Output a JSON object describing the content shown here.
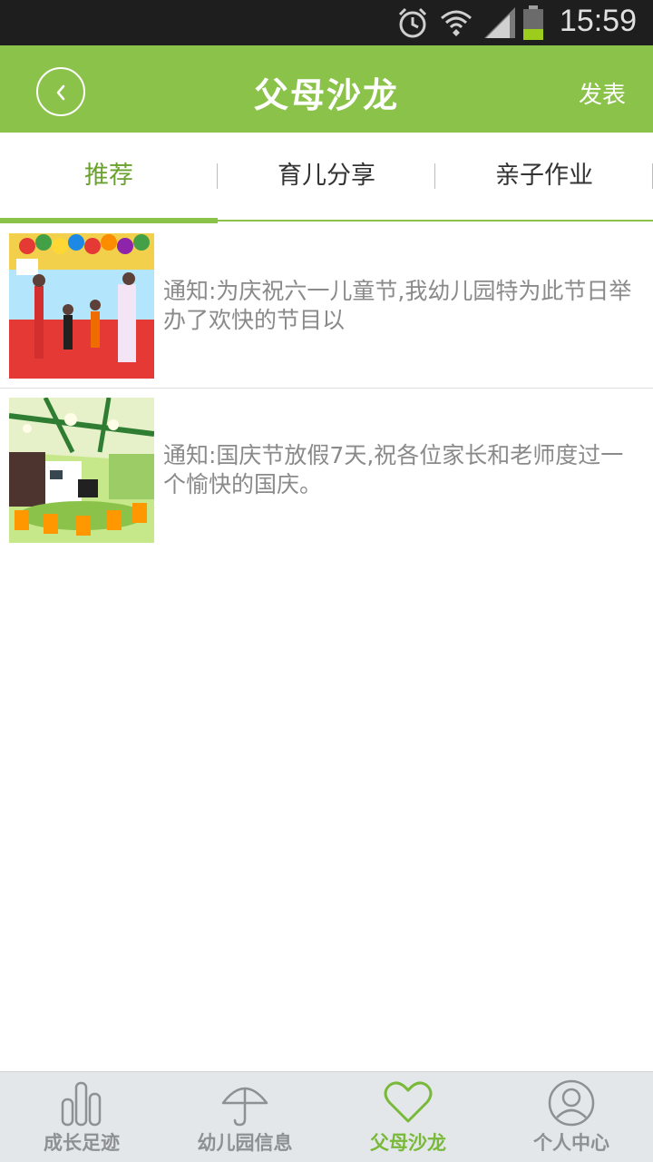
{
  "status_bar": {
    "time": "15:59",
    "icons": [
      "alarm-icon",
      "wifi-icon",
      "signal-icon",
      "battery-icon"
    ]
  },
  "header": {
    "title": "父母沙龙",
    "publish_label": "发表",
    "back_icon": "chevron-left-icon"
  },
  "tabs": [
    {
      "label": "推荐",
      "active": true
    },
    {
      "label": "育儿分享",
      "active": false
    },
    {
      "label": "亲子作业",
      "active": false
    }
  ],
  "posts": [
    {
      "text": "通知:为庆祝六一儿童节,我幼儿园特为此节日举办了欢快的节目以",
      "thumb": "performance-stage-photo"
    },
    {
      "text": "通知:国庆节放假7天,祝各位家长和老师度过一个愉快的国庆。",
      "thumb": "classroom-photo"
    }
  ],
  "bottom_nav": [
    {
      "label": "成长足迹",
      "icon": "bar-chart-icon",
      "active": false
    },
    {
      "label": "幼儿园信息",
      "icon": "umbrella-icon",
      "active": false
    },
    {
      "label": "父母沙龙",
      "icon": "heart-icon",
      "active": true
    },
    {
      "label": "个人中心",
      "icon": "person-icon",
      "active": false
    }
  ],
  "colors": {
    "accent": "#8bc34a",
    "accent_text": "#6aa12f",
    "status_bar": "#1e1e1e",
    "nav_background": "#e4e7ea"
  }
}
